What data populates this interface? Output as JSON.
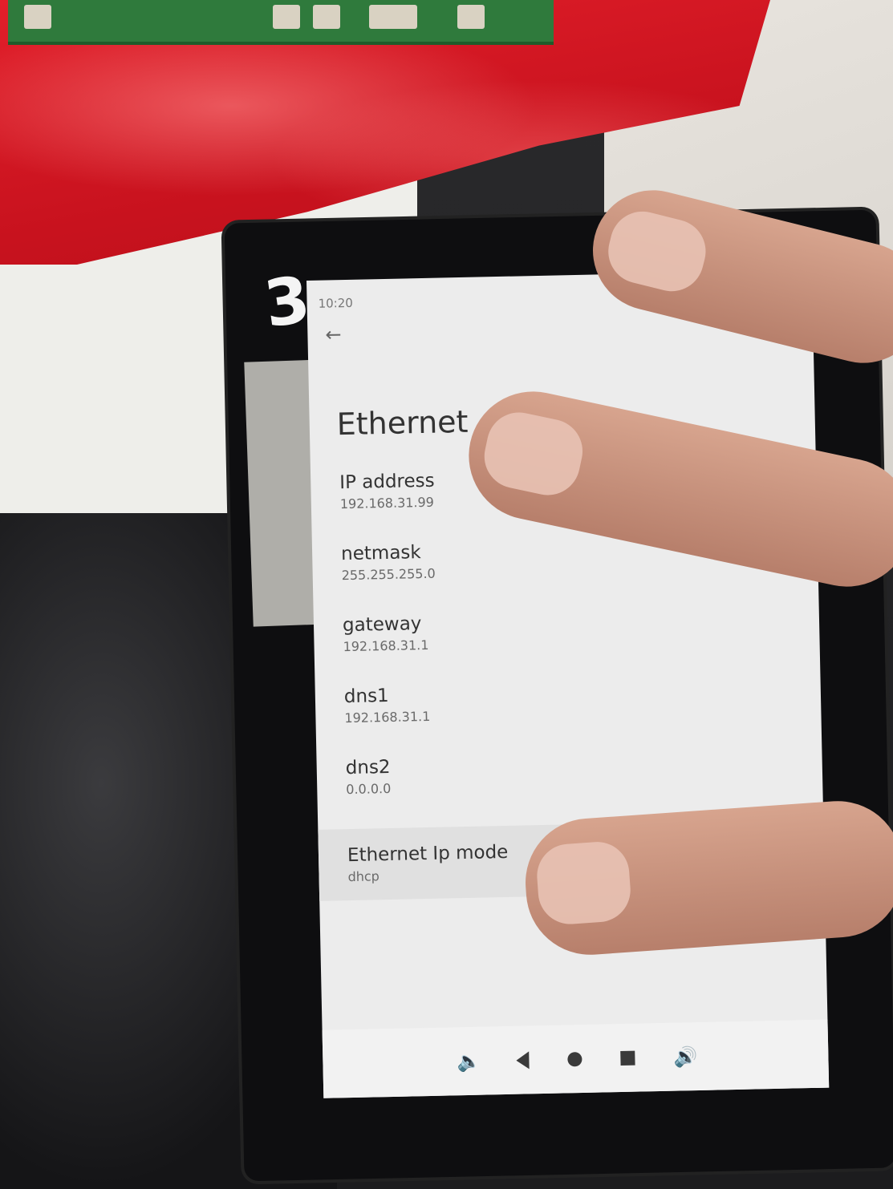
{
  "status_bar": {
    "time": "10:20"
  },
  "header": {
    "back_icon": "arrow-left-icon",
    "title": "Ethernet"
  },
  "settings": [
    {
      "label": "IP address",
      "value": "192.168.31.99"
    },
    {
      "label": "netmask",
      "value": "255.255.255.0"
    },
    {
      "label": "gateway",
      "value": "192.168.31.1"
    },
    {
      "label": "dns1",
      "value": "192.168.31.1"
    },
    {
      "label": "dns2",
      "value": "0.0.0.0"
    },
    {
      "label": "Ethernet Ip mode",
      "value": "dhcp"
    }
  ],
  "navbar": {
    "icons": [
      "volume-down-icon",
      "back-triangle-icon",
      "home-circle-icon",
      "recents-square-icon",
      "volume-up-icon"
    ]
  },
  "photo_props": {
    "device_tape_number": "3"
  },
  "colors": {
    "screen_bg": "#ececec",
    "text": "#333333",
    "subtext": "#6a6a6a"
  }
}
